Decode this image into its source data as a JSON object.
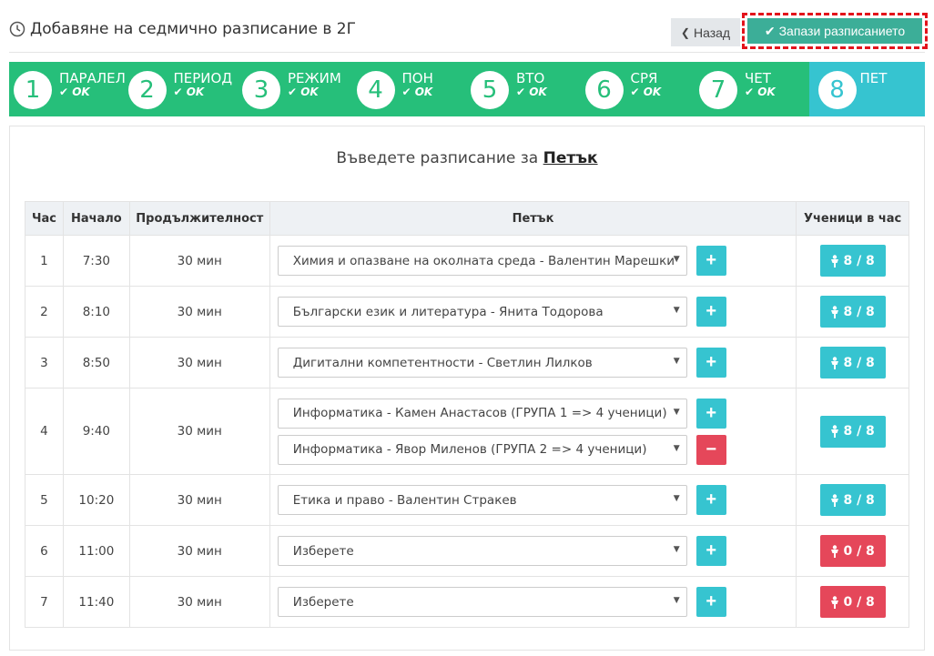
{
  "header": {
    "title": "Добавяне на седмично разписание в 2Г",
    "back_label": "Назад",
    "save_label": "Запази разписанието"
  },
  "wizard": {
    "steps": [
      {
        "num": "1",
        "label": "ПАРАЛЕЛ",
        "status": "OK"
      },
      {
        "num": "2",
        "label": "ПЕРИОД",
        "status": "OK"
      },
      {
        "num": "3",
        "label": "РЕЖИМ",
        "status": "OK"
      },
      {
        "num": "4",
        "label": "ПОН",
        "status": "OK"
      },
      {
        "num": "5",
        "label": "ВТО",
        "status": "OK"
      },
      {
        "num": "6",
        "label": "СРЯ",
        "status": "OK"
      },
      {
        "num": "7",
        "label": "ЧЕТ",
        "status": "OK"
      },
      {
        "num": "8",
        "label": "ПЕТ",
        "status": ""
      }
    ]
  },
  "prompt": {
    "text": "Въведете разписание за ",
    "day": "Петък"
  },
  "table": {
    "headers": [
      "Час",
      "Начало",
      "Продължителност",
      "Петък",
      "Ученици в час"
    ],
    "rows": [
      {
        "hour": "1",
        "start": "7:30",
        "duration": "30 мин",
        "subjects": [
          "Химия и опазване на околната среда - Валентин Марешки"
        ],
        "students": "8 / 8",
        "full": true
      },
      {
        "hour": "2",
        "start": "8:10",
        "duration": "30 мин",
        "subjects": [
          "Български език и литература - Янита Тодорова"
        ],
        "students": "8 / 8",
        "full": true
      },
      {
        "hour": "3",
        "start": "8:50",
        "duration": "30 мин",
        "subjects": [
          "Дигитални компетентности - Светлин Лилков"
        ],
        "students": "8 / 8",
        "full": true
      },
      {
        "hour": "4",
        "start": "9:40",
        "duration": "30 мин",
        "subjects": [
          "Информатика - Камен Анастасов (ГРУПА 1 => 4 ученици)",
          "Информатика - Явор Миленов (ГРУПА 2 => 4 ученици)"
        ],
        "students": "8 / 8",
        "full": true
      },
      {
        "hour": "5",
        "start": "10:20",
        "duration": "30 мин",
        "subjects": [
          "Етика и право - Валентин Стракев"
        ],
        "students": "8 / 8",
        "full": true
      },
      {
        "hour": "6",
        "start": "11:00",
        "duration": "30 мин",
        "subjects": [
          "Изберете"
        ],
        "students": "0 / 8",
        "full": false
      },
      {
        "hour": "7",
        "start": "11:40",
        "duration": "30 мин",
        "subjects": [
          "Изберете"
        ],
        "students": "0 / 8",
        "full": false
      }
    ]
  },
  "colors": {
    "wizard_green": "#26bf7a",
    "wizard_active": "#36c4d0",
    "save_button": "#3cae98",
    "add_button": "#36c4d0",
    "remove_button": "#e5475a",
    "highlight_border": "#e3131b"
  }
}
